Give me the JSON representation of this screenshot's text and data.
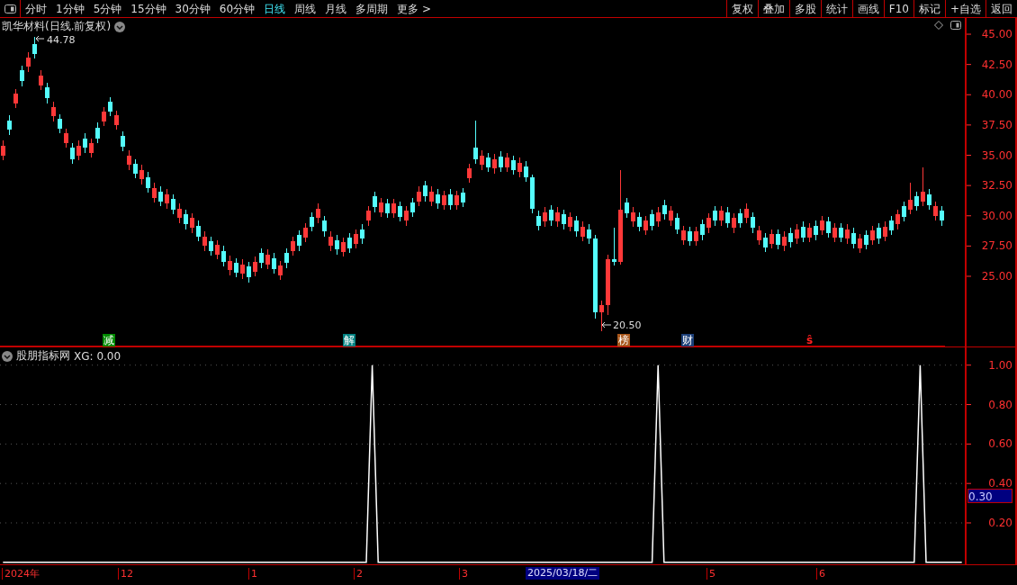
{
  "toolbar": {
    "periods": [
      {
        "label": "分时",
        "selected": false
      },
      {
        "label": "1分钟",
        "selected": false
      },
      {
        "label": "5分钟",
        "selected": false
      },
      {
        "label": "15分钟",
        "selected": false
      },
      {
        "label": "30分钟",
        "selected": false
      },
      {
        "label": "60分钟",
        "selected": false
      },
      {
        "label": "日线",
        "selected": true
      },
      {
        "label": "周线",
        "selected": false
      },
      {
        "label": "月线",
        "selected": false
      },
      {
        "label": "多周期",
        "selected": false
      },
      {
        "label": "更多 >",
        "selected": false
      }
    ],
    "buttons": [
      "复权",
      "叠加",
      "多股",
      "统计",
      "画线",
      "F10",
      "标记",
      "+自选",
      "返回"
    ]
  },
  "main_chart": {
    "title": "凯华材料(日线.前复权)",
    "high_label": "44.78",
    "low_label": "20.50",
    "markers": [
      {
        "label": "减",
        "kind": "badge",
        "color": "#008a00"
      },
      {
        "label": "解",
        "kind": "badge",
        "color": "#008080"
      },
      {
        "label": "榜",
        "kind": "badge",
        "color": "#a8561a"
      },
      {
        "label": "财",
        "kind": "badge",
        "color": "#1c3f78"
      },
      {
        "label": "ŝ",
        "kind": "text",
        "color": "#ff2020"
      }
    ],
    "chart_data": {
      "type": "candlestick",
      "ylim": [
        19.2,
        46.34
      ],
      "yticks": [
        {
          "value": 45,
          "label": "45.00"
        },
        {
          "value": 42.5,
          "label": "42.50"
        },
        {
          "value": 40,
          "label": "40.00"
        },
        {
          "value": 37.5,
          "label": "37.50"
        },
        {
          "value": 35,
          "label": "35.00"
        },
        {
          "value": 32.5,
          "label": "32.50"
        },
        {
          "value": 30,
          "label": "30.00"
        },
        {
          "value": 27.5,
          "label": "27.50"
        },
        {
          "value": 25,
          "label": "25.00"
        }
      ],
      "categories": [
        null,
        null,
        null,
        null,
        null,
        null,
        null,
        null,
        null,
        null,
        null,
        null,
        null,
        null,
        null,
        null,
        null,
        null,
        null,
        null,
        null,
        null,
        null,
        null,
        null,
        null,
        null,
        null,
        null,
        null,
        null,
        null,
        null,
        null,
        null,
        null,
        null,
        null,
        null,
        null,
        null,
        null,
        null,
        null,
        null,
        null,
        null,
        null,
        null,
        null,
        null,
        null,
        null,
        null,
        null,
        null,
        null,
        null,
        null,
        null,
        null,
        null,
        null,
        null,
        null,
        null,
        null,
        null,
        null,
        null,
        null,
        null,
        null,
        null,
        null,
        null,
        null,
        null,
        null,
        null,
        null,
        null,
        null,
        null,
        null,
        null,
        null,
        null,
        null,
        null,
        null,
        null,
        null,
        null,
        null,
        null,
        null,
        null,
        null,
        null,
        null,
        null,
        null,
        null,
        null,
        null,
        null,
        null,
        null,
        null,
        null,
        null,
        null,
        null,
        null,
        null,
        null,
        null,
        null,
        null,
        null,
        null,
        null,
        null,
        null,
        null,
        null,
        null,
        null,
        null,
        null,
        null,
        null,
        null,
        null,
        null,
        null,
        null,
        null,
        null,
        null,
        null,
        null,
        null,
        null,
        null,
        null,
        null,
        null,
        null
      ],
      "ohlc": [
        [
          35.0,
          36.2,
          34.6,
          35.8
        ],
        [
          37.9,
          38.3,
          36.7,
          37.1
        ],
        [
          39.3,
          40.5,
          38.9,
          40.1
        ],
        [
          42.0,
          42.4,
          40.7,
          41.1
        ],
        [
          42.3,
          43.5,
          41.9,
          43.1
        ],
        [
          44.2,
          44.78,
          43.0,
          43.4
        ],
        [
          40.8,
          42.0,
          40.4,
          41.6
        ],
        [
          40.6,
          41.0,
          39.3,
          39.7
        ],
        [
          38.2,
          39.4,
          37.8,
          39.0
        ],
        [
          38.0,
          38.4,
          36.8,
          37.2
        ],
        [
          36.0,
          37.2,
          35.6,
          36.8
        ],
        [
          35.6,
          36.0,
          34.3,
          34.7
        ],
        [
          35.0,
          36.2,
          34.6,
          35.8
        ],
        [
          36.4,
          36.8,
          35.2,
          35.6
        ],
        [
          35.2,
          36.4,
          34.8,
          36.0
        ],
        [
          37.3,
          37.7,
          36.0,
          36.4
        ],
        [
          37.8,
          39.0,
          37.4,
          38.6
        ],
        [
          39.4,
          39.8,
          38.2,
          38.6
        ],
        [
          37.5,
          38.7,
          37.1,
          38.3
        ],
        [
          36.6,
          37.0,
          35.3,
          35.7
        ],
        [
          34.2,
          35.4,
          33.8,
          35.0
        ],
        [
          34.3,
          34.7,
          33.1,
          33.5
        ],
        [
          33.0,
          34.2,
          32.6,
          33.8
        ],
        [
          33.2,
          33.6,
          31.9,
          32.3
        ],
        [
          31.5,
          32.7,
          31.1,
          32.3
        ],
        [
          32.0,
          32.4,
          30.8,
          31.2
        ],
        [
          31.0,
          32.2,
          30.6,
          31.8
        ],
        [
          31.4,
          31.8,
          30.1,
          30.5
        ],
        [
          29.8,
          31.0,
          29.4,
          30.6
        ],
        [
          30.1,
          30.5,
          28.9,
          29.3
        ],
        [
          29.0,
          30.2,
          28.6,
          29.8
        ],
        [
          29.2,
          29.6,
          27.9,
          28.3
        ],
        [
          27.5,
          28.7,
          27.1,
          28.3
        ],
        [
          27.9,
          28.3,
          26.7,
          27.1
        ],
        [
          26.8,
          28.0,
          26.4,
          27.6
        ],
        [
          27.1,
          27.5,
          25.8,
          26.2
        ],
        [
          25.5,
          26.7,
          25.1,
          26.3
        ],
        [
          26.1,
          26.5,
          24.9,
          25.3
        ],
        [
          25.2,
          26.4,
          24.8,
          26.0
        ],
        [
          25.8,
          26.2,
          24.5,
          24.9
        ],
        [
          25.4,
          26.6,
          25.0,
          26.2
        ],
        [
          26.9,
          27.3,
          25.7,
          26.1
        ],
        [
          26.0,
          27.2,
          25.6,
          26.8
        ],
        [
          26.5,
          26.9,
          25.2,
          25.6
        ],
        [
          25.1,
          26.3,
          24.7,
          25.9
        ],
        [
          26.9,
          27.3,
          25.7,
          26.1
        ],
        [
          27.1,
          28.3,
          26.7,
          27.9
        ],
        [
          28.4,
          28.8,
          27.1,
          27.5
        ],
        [
          28.2,
          29.4,
          27.8,
          29.0
        ],
        [
          29.9,
          30.3,
          28.7,
          29.1
        ],
        [
          29.8,
          31.0,
          29.4,
          30.6
        ],
        [
          29.6,
          30.0,
          28.3,
          28.7
        ],
        [
          27.5,
          28.7,
          27.1,
          28.3
        ],
        [
          28.0,
          28.4,
          26.8,
          27.2
        ],
        [
          27.0,
          28.2,
          26.6,
          27.8
        ],
        [
          28.2,
          28.6,
          26.9,
          27.3
        ],
        [
          27.7,
          28.9,
          27.3,
          28.5
        ],
        [
          28.9,
          29.3,
          27.7,
          28.1
        ],
        [
          29.6,
          30.8,
          29.2,
          30.4
        ],
        [
          31.6,
          32.0,
          30.3,
          30.7
        ],
        [
          30.3,
          31.5,
          29.9,
          31.1
        ],
        [
          31.0,
          31.4,
          29.8,
          30.2
        ],
        [
          30.2,
          31.4,
          29.8,
          31.0
        ],
        [
          30.8,
          31.2,
          29.5,
          29.9
        ],
        [
          29.6,
          30.8,
          29.2,
          30.4
        ],
        [
          31.1,
          31.5,
          29.9,
          30.3
        ],
        [
          31.2,
          32.4,
          30.8,
          32.0
        ],
        [
          32.5,
          32.9,
          31.2,
          31.6
        ],
        [
          31.2,
          32.4,
          30.8,
          32.0
        ],
        [
          31.8,
          32.2,
          30.6,
          31.0
        ],
        [
          30.9,
          32.1,
          30.5,
          31.7
        ],
        [
          31.8,
          32.2,
          30.5,
          30.9
        ],
        [
          30.9,
          32.1,
          30.5,
          31.7
        ],
        [
          31.9,
          32.3,
          30.7,
          31.1
        ],
        [
          33.1,
          34.3,
          32.7,
          33.9
        ],
        [
          35.6,
          37.9,
          34.3,
          34.7
        ],
        [
          34.2,
          35.4,
          33.8,
          35.0
        ],
        [
          34.8,
          35.2,
          33.6,
          34.0
        ],
        [
          33.9,
          35.1,
          33.5,
          34.7
        ],
        [
          34.9,
          35.3,
          33.6,
          34.0
        ],
        [
          34.0,
          35.2,
          33.6,
          34.8
        ],
        [
          34.6,
          35.0,
          33.4,
          33.8
        ],
        [
          33.6,
          34.8,
          33.2,
          34.4
        ],
        [
          34.1,
          34.5,
          32.8,
          33.2
        ],
        [
          33.2,
          33.4,
          30.2,
          30.6
        ],
        [
          30.0,
          30.4,
          28.8,
          29.2
        ],
        [
          29.5,
          30.7,
          29.1,
          30.3
        ],
        [
          30.5,
          30.9,
          29.2,
          29.6
        ],
        [
          29.5,
          30.7,
          29.1,
          30.3
        ],
        [
          30.1,
          30.5,
          28.9,
          29.3
        ],
        [
          29.1,
          30.3,
          28.7,
          29.9
        ],
        [
          29.6,
          30.0,
          28.3,
          28.7
        ],
        [
          28.3,
          29.5,
          27.9,
          29.1
        ],
        [
          28.9,
          29.3,
          27.7,
          28.1
        ],
        [
          28.1,
          28.4,
          21.5,
          22.0
        ],
        [
          22.0,
          23.0,
          20.5,
          22.6
        ],
        [
          22.6,
          26.8,
          21.8,
          26.4
        ],
        [
          26.4,
          29.0,
          25.9,
          26.2
        ],
        [
          26.2,
          33.8,
          26.0,
          30.5
        ],
        [
          31.1,
          31.5,
          29.8,
          30.2
        ],
        [
          29.5,
          30.7,
          29.1,
          30.3
        ],
        [
          29.9,
          30.3,
          28.7,
          29.1
        ],
        [
          28.8,
          30.0,
          28.4,
          29.6
        ],
        [
          30.1,
          30.5,
          28.8,
          29.2
        ],
        [
          29.5,
          30.7,
          29.1,
          30.3
        ],
        [
          30.9,
          31.3,
          29.7,
          30.1
        ],
        [
          29.6,
          30.8,
          29.2,
          30.4
        ],
        [
          29.8,
          30.2,
          28.5,
          28.9
        ],
        [
          28.0,
          29.2,
          27.6,
          28.8
        ],
        [
          28.7,
          29.1,
          27.5,
          27.9
        ],
        [
          27.9,
          29.1,
          27.5,
          28.7
        ],
        [
          29.3,
          29.7,
          28.0,
          28.4
        ],
        [
          29.0,
          30.2,
          28.6,
          29.8
        ],
        [
          30.4,
          30.8,
          29.2,
          29.6
        ],
        [
          29.6,
          30.8,
          29.2,
          30.4
        ],
        [
          30.3,
          30.7,
          29.0,
          29.4
        ],
        [
          29.0,
          30.2,
          28.6,
          29.8
        ],
        [
          30.2,
          30.6,
          29.0,
          29.4
        ],
        [
          29.8,
          31.0,
          29.4,
          30.6
        ],
        [
          29.9,
          30.3,
          28.6,
          29.0
        ],
        [
          28.0,
          29.2,
          27.6,
          28.8
        ],
        [
          28.2,
          28.6,
          27.0,
          27.4
        ],
        [
          27.7,
          28.9,
          27.3,
          28.5
        ],
        [
          28.5,
          28.9,
          27.2,
          27.6
        ],
        [
          27.5,
          28.7,
          27.1,
          28.3
        ],
        [
          28.6,
          29.0,
          27.4,
          27.8
        ],
        [
          28.1,
          29.3,
          27.7,
          28.9
        ],
        [
          29.1,
          29.5,
          27.8,
          28.2
        ],
        [
          28.2,
          29.4,
          27.8,
          29.0
        ],
        [
          29.2,
          29.6,
          28.0,
          28.4
        ],
        [
          28.8,
          30.0,
          28.4,
          29.6
        ],
        [
          29.5,
          29.9,
          28.2,
          28.6
        ],
        [
          28.2,
          29.4,
          27.8,
          29.0
        ],
        [
          29.0,
          29.4,
          27.8,
          28.2
        ],
        [
          28.1,
          29.3,
          27.7,
          28.9
        ],
        [
          28.6,
          29.0,
          27.3,
          27.7
        ],
        [
          27.3,
          28.5,
          26.9,
          28.1
        ],
        [
          28.4,
          28.8,
          27.2,
          27.6
        ],
        [
          28.0,
          29.2,
          27.6,
          28.8
        ],
        [
          29.0,
          29.4,
          27.7,
          28.1
        ],
        [
          28.3,
          29.5,
          27.9,
          29.1
        ],
        [
          29.6,
          30.0,
          28.4,
          28.8
        ],
        [
          29.3,
          30.5,
          28.9,
          30.1
        ],
        [
          30.8,
          31.2,
          29.5,
          29.9
        ],
        [
          30.5,
          32.7,
          30.1,
          31.3
        ],
        [
          31.6,
          32.0,
          30.4,
          30.8
        ],
        [
          31.2,
          34.0,
          30.8,
          32.0
        ],
        [
          31.8,
          32.2,
          30.5,
          30.9
        ],
        [
          30.0,
          31.2,
          29.6,
          30.8
        ],
        [
          30.4,
          30.8,
          29.2,
          29.6
        ]
      ]
    }
  },
  "indicator": {
    "name": "股朋指标网",
    "reading": ": 0.00",
    "cursor_value": "0.30",
    "chart_data": {
      "type": "line",
      "grid": true,
      "ylim": [
        -0.01,
        1.09
      ],
      "yticks": [
        {
          "value": 1,
          "label": "1.00"
        },
        {
          "value": 0.8,
          "label": "0.80"
        },
        {
          "value": 0.6,
          "label": "0.60"
        },
        {
          "value": 0.4,
          "label": "0.40"
        },
        {
          "value": 0.2,
          "label": "0.20"
        }
      ],
      "categories": [
        null,
        null,
        null,
        null,
        null,
        null,
        null,
        null,
        null,
        null,
        null,
        null,
        null,
        null,
        null,
        null,
        null,
        null,
        null,
        null,
        null,
        null,
        null,
        null,
        null,
        null,
        null,
        null,
        null,
        null,
        null,
        null,
        null,
        null,
        null,
        null,
        null,
        null,
        null,
        null,
        null,
        null,
        null,
        null,
        null,
        null,
        null,
        null,
        null,
        null,
        null,
        null,
        null,
        null,
        null,
        null,
        null,
        null,
        null,
        null,
        null,
        null,
        null,
        null,
        null,
        null,
        null,
        null,
        null,
        null,
        null,
        null,
        null,
        null,
        null,
        null,
        null,
        null,
        null,
        null,
        null,
        null,
        null,
        null,
        null,
        null,
        null,
        null,
        null,
        null,
        null,
        null,
        null,
        null,
        null,
        null,
        null,
        null,
        null,
        null,
        null,
        null,
        null,
        null,
        null,
        null,
        null,
        null,
        null,
        null,
        null,
        null,
        null,
        null,
        null,
        null,
        null,
        null,
        null,
        null,
        null,
        null,
        null,
        null,
        null,
        null,
        null,
        null,
        null,
        null,
        null,
        null,
        null,
        null,
        null,
        null,
        null,
        null,
        null,
        null,
        null,
        null,
        null,
        null,
        null,
        null,
        null,
        null,
        null,
        null,
        null,
        null,
        null,
        null,
        null,
        null,
        null,
        null,
        null,
        null,
        null,
        null
      ],
      "series": [
        {
          "name": "XG",
          "color": "#ffffff",
          "values": [
            0,
            0,
            0,
            0,
            0,
            0,
            0,
            0,
            0,
            0,
            0,
            0,
            0,
            0,
            0,
            0,
            0,
            0,
            0,
            0,
            0,
            0,
            0,
            0,
            0,
            0,
            0,
            0,
            0,
            0,
            0,
            0,
            0,
            0,
            0,
            0,
            0,
            0,
            0,
            0,
            0,
            0,
            0,
            0,
            0,
            0,
            0,
            0,
            0,
            0,
            0,
            0,
            0,
            0,
            0,
            0,
            0,
            0,
            0,
            0,
            0,
            0,
            1,
            0,
            0,
            0,
            0,
            0,
            0,
            0,
            0,
            0,
            0,
            0,
            0,
            0,
            0,
            0,
            0,
            0,
            0,
            0,
            0,
            0,
            0,
            0,
            0,
            0,
            0,
            0,
            0,
            0,
            0,
            0,
            0,
            0,
            0,
            0,
            0,
            0,
            0,
            0,
            0,
            0,
            0,
            0,
            0,
            0,
            0,
            0,
            1,
            0,
            0,
            0,
            0,
            0,
            0,
            0,
            0,
            0,
            0,
            0,
            0,
            0,
            0,
            0,
            0,
            0,
            0,
            0,
            0,
            0,
            0,
            0,
            0,
            0,
            0,
            0,
            0,
            0,
            0,
            0,
            0,
            0,
            0,
            0,
            0,
            0,
            0,
            0,
            0,
            0,
            0,
            0,
            1,
            0,
            0,
            0,
            0,
            0,
            0,
            0
          ]
        }
      ]
    }
  },
  "x_axis": {
    "labels": [
      "2024年",
      "12",
      "1",
      "2",
      "3",
      "5",
      "6"
    ],
    "cursor_label": "2025/03/18/二"
  }
}
